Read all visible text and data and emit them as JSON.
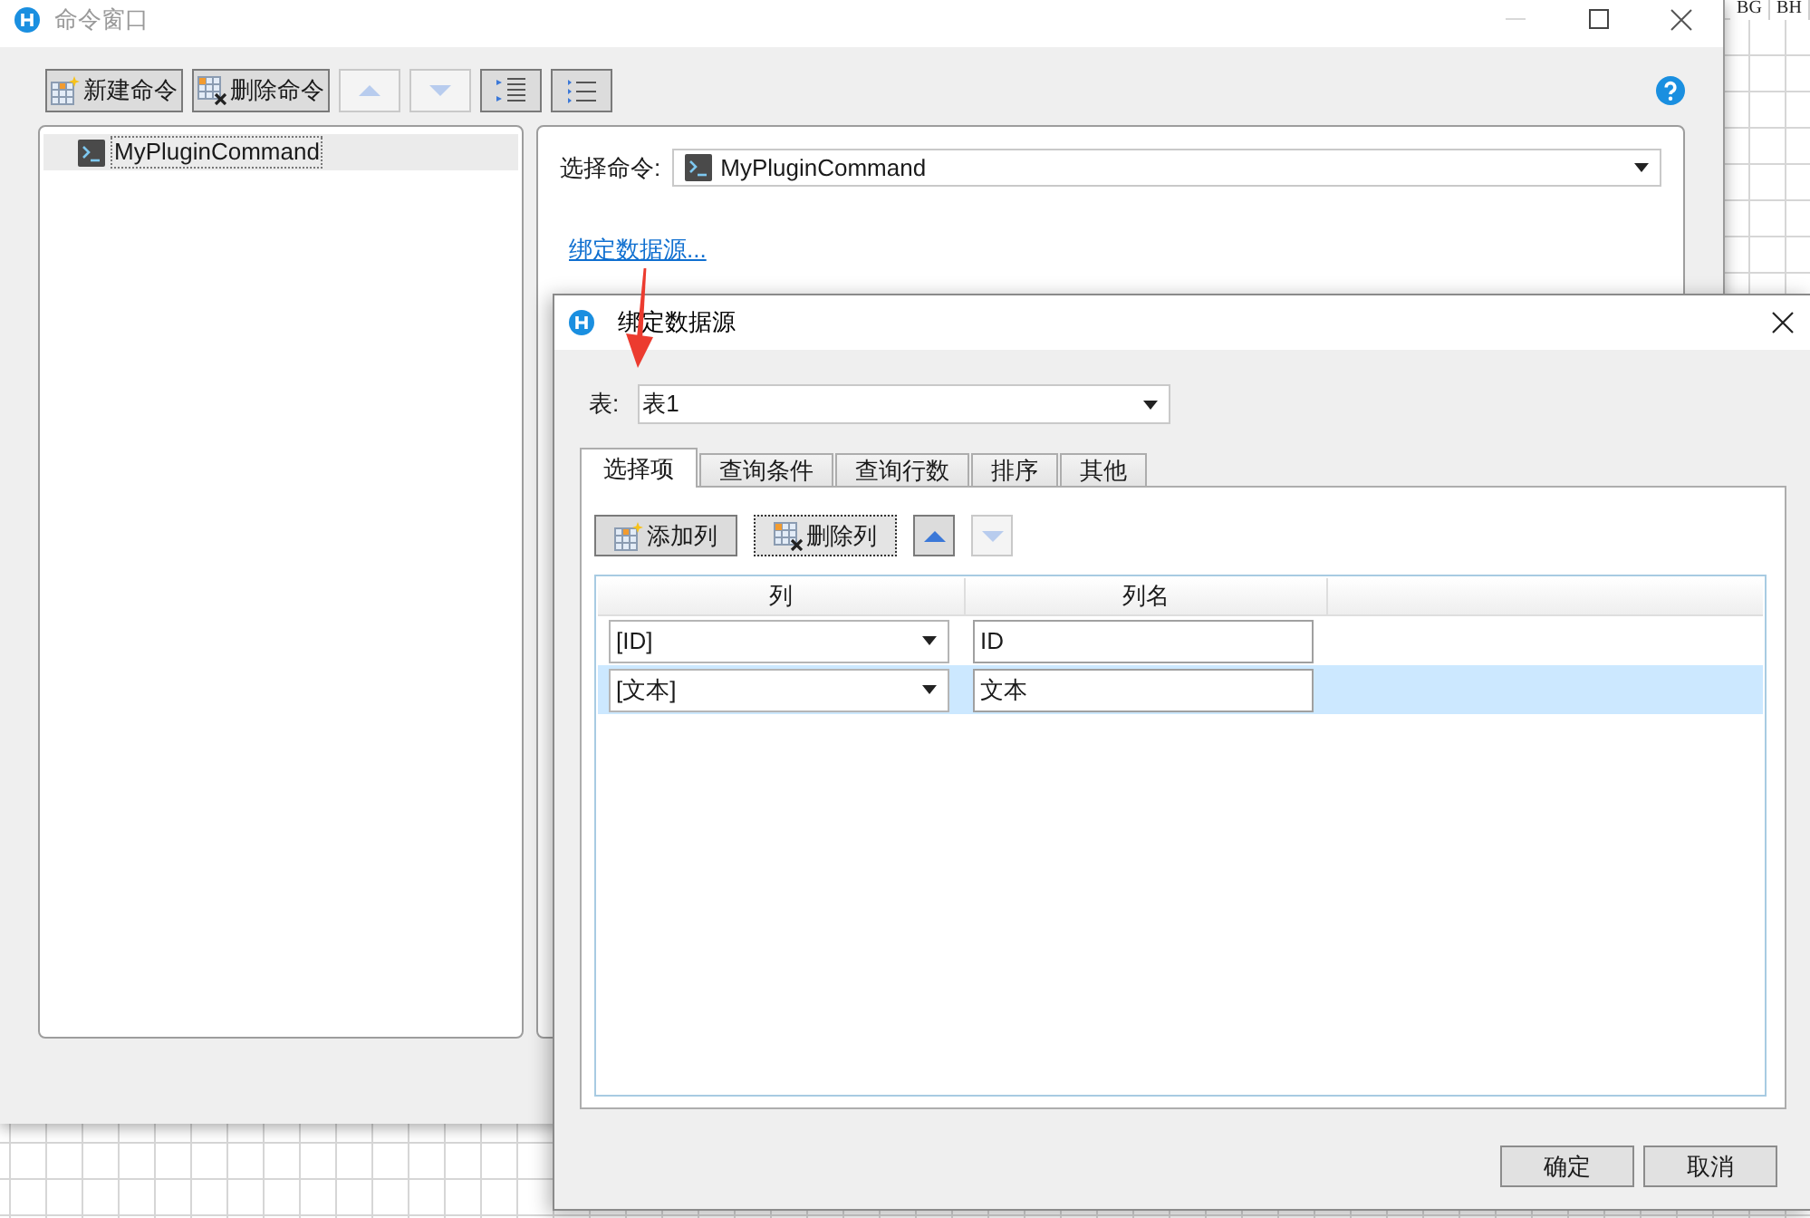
{
  "sheet": {
    "column_headers": [
      "BG",
      "BH"
    ]
  },
  "command_window": {
    "title": "命令窗口",
    "active": false,
    "toolbar": [
      {
        "kind": "new",
        "label": "新建命令",
        "disabled": false
      },
      {
        "kind": "delete",
        "label": "删除命令",
        "disabled": false
      },
      {
        "kind": "up",
        "disabled": true
      },
      {
        "kind": "down",
        "disabled": true
      },
      {
        "kind": "indent",
        "disabled": false
      },
      {
        "kind": "list",
        "disabled": false
      }
    ],
    "tree": {
      "items": [
        {
          "label": "MyPluginCommand",
          "selected": true
        }
      ]
    },
    "command_field": {
      "label": "选择命令:",
      "value": "MyPluginCommand"
    },
    "bind_link": "绑定数据源..."
  },
  "dialog": {
    "title": "绑定数据源",
    "active": true,
    "table_field": {
      "label": "表:",
      "value": "表1"
    },
    "tabs": [
      {
        "label": "选择项",
        "selected": true
      },
      {
        "label": "查询条件",
        "selected": false
      },
      {
        "label": "查询行数",
        "selected": false
      },
      {
        "label": "排序",
        "selected": false
      },
      {
        "label": "其他",
        "selected": false
      }
    ],
    "toolbar": [
      {
        "kind": "add",
        "label": "添加列",
        "disabled": false,
        "focused": false
      },
      {
        "kind": "delete",
        "label": "删除列",
        "disabled": false,
        "focused": true
      },
      {
        "kind": "up",
        "disabled": false,
        "focused": false
      },
      {
        "kind": "down",
        "disabled": true,
        "focused": false
      }
    ],
    "grid": {
      "columns": [
        "列",
        "列名"
      ],
      "rows": [
        {
          "column": "[ID]",
          "name": "ID",
          "selected": false
        },
        {
          "column": "[文本]",
          "name": "文本",
          "selected": true
        }
      ]
    },
    "buttons": [
      "确定",
      "取消"
    ]
  }
}
